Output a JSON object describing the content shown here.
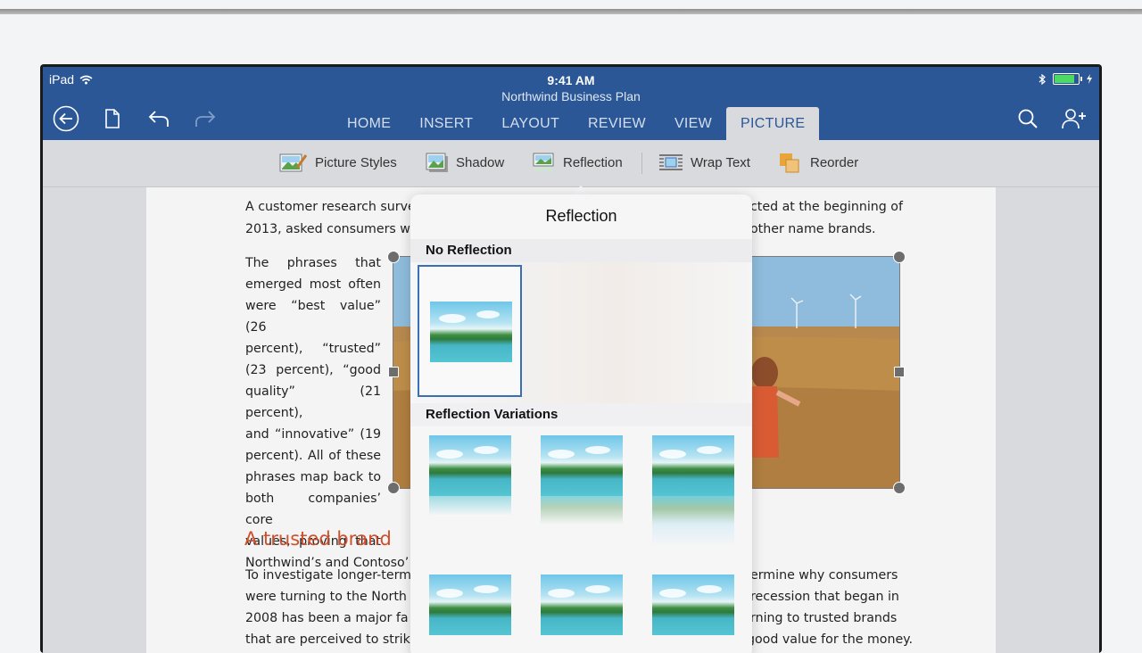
{
  "status": {
    "carrier": "iPad",
    "time": "9:41 AM",
    "battery_level": 0.9
  },
  "document": {
    "title": "Northwind Business Plan"
  },
  "tabs": [
    "HOME",
    "INSERT",
    "LAYOUT",
    "REVIEW",
    "VIEW",
    "PICTURE"
  ],
  "active_tab": "PICTURE",
  "ribbon": {
    "picture_styles": "Picture Styles",
    "shadow": "Shadow",
    "reflection": "Reflection",
    "wrap_text": "Wrap Text",
    "reorder": "Reorder"
  },
  "body": {
    "p1_l1a": "A customer research surve",
    "p1_l1b": "cted at the beginning of",
    "p1_l2a": "2013, asked consumers wl",
    "p1_l2b": "other name brands.",
    "p2_lines": [
      "The phrases that",
      "emerged most often",
      "were “best value” (26",
      "percent), “trusted”",
      "(23 percent), “good",
      "quality” (21 percent),",
      "and “innovative” (19",
      "percent). All of these",
      "phrases map back to",
      "both companies’ core",
      "values, proving that",
      "Northwind’s and Contoso’"
    ],
    "heading": "A trusted brand",
    "p3_l1a": "To investigate longer-term",
    "p3_l1b": "ermine why consumers",
    "p3_l2a": "were turning to the North",
    "p3_l2b": "recession that began in",
    "p3_l3a": "2008 has been a major fa",
    "p3_l3b": "rning to trusted brands",
    "p3_l4": "that are perceived to strike the proper balance of being good quality yet still a good value for the money."
  },
  "popover": {
    "title": "Reflection",
    "no_reflection": "No Reflection",
    "variations": "Reflection Variations"
  },
  "colors": {
    "accent": "#2b5797",
    "heading": "#d14f2a",
    "selection": "#3b6fb5"
  }
}
